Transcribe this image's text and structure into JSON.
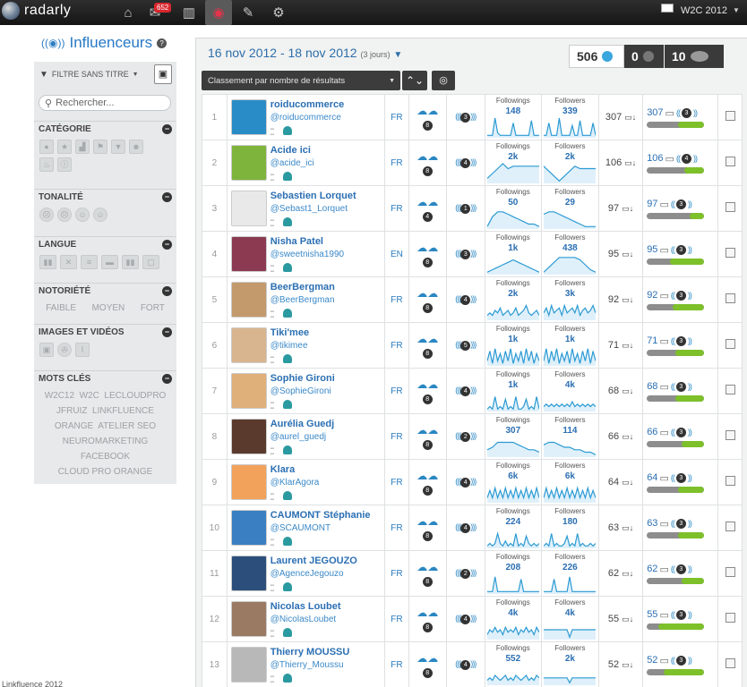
{
  "app": {
    "logo": "radarly",
    "project": "W2C 2012",
    "notif_count": "652"
  },
  "nav": [
    {
      "name": "home-icon",
      "glyph": "⌂"
    },
    {
      "name": "messages-icon",
      "glyph": "✉"
    },
    {
      "name": "stats-icon",
      "glyph": "▥"
    },
    {
      "name": "influencers-icon",
      "glyph": "◉"
    },
    {
      "name": "edit-icon",
      "glyph": "✎"
    },
    {
      "name": "settings-icon",
      "glyph": "⚙"
    }
  ],
  "sidebar": {
    "title": "Influenceurs",
    "filter": "FILTRE SANS TITRE",
    "search_placeholder": "Rechercher...",
    "sections": {
      "category": "CATÉGORIE",
      "tone": "TONALITÉ",
      "language": "LANGUE",
      "notoriety": "NOTORIÉTÉ",
      "media": "IMAGES ET VIDÉOS",
      "keywords": "MOTS CLÉS"
    },
    "notoriety_levels": [
      "FAIBLE",
      "MOYEN",
      "FORT"
    ],
    "keywords": [
      "W2C12",
      "W2C",
      "LECLOUDPRO",
      "JFRUIZ",
      "LINKFLUENCE",
      "ORANGE",
      "ATELIER SEO",
      "NEUROMARKETING",
      "FACEBOOK",
      "CLOUD PRO ORANGE"
    ]
  },
  "header": {
    "date_range": "16 nov 2012 - 18 nov 2012",
    "days": "(3 jours)",
    "twitter_count": "506",
    "facebook_count": "0",
    "other_count": "10",
    "sort_label": "Classement par nombre de résultats"
  },
  "columns": {
    "followings": "Followings",
    "followers": "Followers"
  },
  "rows": [
    {
      "rank": "1",
      "name": "roiducommerce",
      "handle": "@roiducommerce",
      "lang": "FR",
      "ring": "8",
      "ring2": "3",
      "followings": "148",
      "followers": "339",
      "score": "307",
      "reach": "307",
      "reach_ring": "3",
      "bar": 0.45,
      "avatar": "#2a8cc6",
      "ch1": [
        1,
        1,
        1,
        8,
        2,
        1,
        1,
        1,
        1,
        1,
        6,
        1,
        1,
        1,
        1,
        1,
        1,
        7,
        1,
        1,
        1
      ],
      "ch2": [
        1,
        1,
        6,
        1,
        1,
        1,
        8,
        1,
        1,
        1,
        1,
        5,
        1,
        1,
        7,
        1,
        1,
        1,
        1,
        6,
        1
      ]
    },
    {
      "rank": "2",
      "name": "Acide ici",
      "handle": "@acide_ici",
      "lang": "FR",
      "ring": "8",
      "ring2": "4",
      "followings": "2k",
      "followers": "2k",
      "score": "106",
      "reach": "106",
      "reach_ring": "4",
      "bar": 0.35,
      "avatar": "#7fb43c",
      "ch1": [
        2,
        4,
        6,
        8,
        6,
        7,
        7,
        7,
        7,
        7,
        7
      ],
      "ch2": [
        7,
        5,
        3,
        1,
        3,
        5,
        7,
        6,
        6,
        6,
        6
      ]
    },
    {
      "rank": "3",
      "name": "Sebastien Lorquet",
      "handle": "@Sebast1_Lorquet",
      "lang": "FR",
      "ring": "4",
      "ring2": "1",
      "followings": "50",
      "followers": "29",
      "score": "97",
      "reach": "97",
      "reach_ring": "3",
      "bar": 0.25,
      "avatar": "#e9e9e9",
      "ch1": [
        1,
        5,
        7,
        7,
        6,
        5,
        4,
        3,
        2,
        2,
        1
      ],
      "ch2": [
        6,
        7,
        7,
        6,
        5,
        4,
        3,
        2,
        1,
        1,
        1
      ]
    },
    {
      "rank": "4",
      "name": "Nisha Patel",
      "handle": "@sweetnisha1990",
      "lang": "EN",
      "ring": "8",
      "ring2": "3",
      "followings": "1k",
      "followers": "438",
      "score": "95",
      "reach": "95",
      "reach_ring": "3",
      "bar": 0.6,
      "avatar": "#8b3a52",
      "ch1": [
        1,
        2,
        3,
        4,
        5,
        6,
        5,
        4,
        3,
        2,
        1
      ],
      "ch2": [
        1,
        3,
        5,
        7,
        7,
        7,
        7,
        6,
        4,
        2,
        1
      ]
    },
    {
      "rank": "5",
      "name": "BeerBergman",
      "handle": "@BeerBergman",
      "lang": "FR",
      "ring": "8",
      "ring2": "4",
      "followings": "2k",
      "followers": "3k",
      "score": "92",
      "reach": "92",
      "reach_ring": "3",
      "bar": 0.55,
      "avatar": "#c39a6b",
      "ch1": [
        2,
        3,
        2,
        4,
        3,
        5,
        2,
        3,
        4,
        2,
        3,
        5,
        2,
        3,
        4,
        6,
        3,
        2,
        3,
        4,
        2
      ],
      "ch2": [
        3,
        5,
        2,
        6,
        3,
        4,
        5,
        2,
        6,
        3,
        4,
        5,
        3,
        6,
        2,
        4,
        5,
        3,
        4,
        6,
        3
      ]
    },
    {
      "rank": "6",
      "name": "Tiki'mee",
      "handle": "@tikimee",
      "lang": "FR",
      "ring": "8",
      "ring2": "5",
      "followings": "1k",
      "followers": "1k",
      "score": "71",
      "reach": "71",
      "reach_ring": "3",
      "bar": 0.5,
      "avatar": "#d9b58f",
      "ch1": [
        2,
        6,
        1,
        7,
        2,
        5,
        1,
        6,
        2,
        7,
        1,
        5,
        2,
        6,
        1,
        7,
        2,
        6,
        1,
        5,
        2
      ],
      "ch2": [
        2,
        7,
        1,
        6,
        2,
        7,
        1,
        5,
        2,
        6,
        1,
        7,
        2,
        5,
        1,
        6,
        2,
        7,
        1,
        6,
        2
      ]
    },
    {
      "rank": "7",
      "name": "Sophie Gironi",
      "handle": "@SophieGironi",
      "lang": "FR",
      "ring": "8",
      "ring2": "4",
      "followings": "1k",
      "followers": "4k",
      "score": "68",
      "reach": "68",
      "reach_ring": "3",
      "bar": 0.5,
      "avatar": "#e0b07a",
      "ch1": [
        1,
        2,
        1,
        6,
        1,
        2,
        1,
        5,
        1,
        2,
        1,
        6,
        1,
        1,
        2,
        5,
        1,
        2,
        1,
        6,
        1
      ],
      "ch2": [
        2,
        3,
        2,
        3,
        2,
        3,
        2,
        3,
        2,
        3,
        2,
        4,
        2,
        3,
        2,
        3,
        2,
        3,
        2,
        3,
        2
      ]
    },
    {
      "rank": "8",
      "name": "Aurélia Guedj",
      "handle": "@aurel_guedj",
      "lang": "FR",
      "ring": "8",
      "ring2": "2",
      "followings": "307",
      "followers": "114",
      "score": "66",
      "reach": "66",
      "reach_ring": "3",
      "bar": 0.4,
      "avatar": "#5b3a2e",
      "ch1": [
        3,
        4,
        6,
        6,
        6,
        6,
        5,
        4,
        3,
        3,
        2
      ],
      "ch2": [
        5,
        6,
        6,
        5,
        4,
        4,
        3,
        3,
        2,
        2,
        1
      ]
    },
    {
      "rank": "9",
      "name": "Klara",
      "handle": "@KlarAgora",
      "lang": "FR",
      "ring": "8",
      "ring2": "4",
      "followings": "6k",
      "followers": "6k",
      "score": "64",
      "reach": "64",
      "reach_ring": "3",
      "bar": 0.45,
      "avatar": "#f2a25a",
      "ch1": [
        2,
        5,
        2,
        6,
        2,
        5,
        2,
        6,
        2,
        5,
        2,
        6,
        2,
        5,
        2,
        6,
        2,
        5,
        2,
        6,
        2
      ],
      "ch2": [
        2,
        6,
        2,
        5,
        2,
        6,
        2,
        5,
        2,
        6,
        2,
        5,
        2,
        6,
        2,
        5,
        2,
        6,
        2,
        5,
        2
      ]
    },
    {
      "rank": "10",
      "name": "CAUMONT Stéphanie",
      "handle": "@SCAUMONT",
      "lang": "FR",
      "ring": "8",
      "ring2": "4",
      "followings": "224",
      "followers": "180",
      "score": "63",
      "reach": "63",
      "reach_ring": "3",
      "bar": 0.45,
      "avatar": "#3a7fc2",
      "ch1": [
        1,
        2,
        1,
        2,
        6,
        2,
        1,
        3,
        1,
        2,
        1,
        6,
        1,
        2,
        1,
        5,
        2,
        1,
        2,
        1,
        2
      ],
      "ch2": [
        1,
        2,
        1,
        6,
        1,
        2,
        1,
        1,
        2,
        5,
        1,
        2,
        1,
        6,
        1,
        2,
        1,
        1,
        2,
        1,
        2
      ]
    },
    {
      "rank": "11",
      "name": "Laurent JEGOUZO",
      "handle": "@AgenceJegouzo",
      "lang": "FR",
      "ring": "8",
      "ring2": "2",
      "followings": "208",
      "followers": "226",
      "score": "62",
      "reach": "62",
      "reach_ring": "3",
      "bar": 0.4,
      "avatar": "#2b4f7a",
      "ch1": [
        1,
        1,
        1,
        7,
        1,
        1,
        1,
        1,
        1,
        1,
        1,
        1,
        1,
        6,
        1,
        1,
        1,
        1,
        1,
        1,
        1
      ],
      "ch2": [
        1,
        1,
        1,
        1,
        6,
        1,
        1,
        1,
        1,
        1,
        7,
        1,
        1,
        1,
        1,
        1,
        1,
        1,
        1,
        1,
        1
      ]
    },
    {
      "rank": "12",
      "name": "Nicolas Loubet",
      "handle": "@NicolasLoubet",
      "lang": "FR",
      "ring": "8",
      "ring2": "4",
      "followings": "4k",
      "followers": "4k",
      "score": "55",
      "reach": "55",
      "reach_ring": "3",
      "bar": 0.8,
      "avatar": "#9a7a62",
      "ch1": [
        2,
        4,
        3,
        5,
        3,
        4,
        2,
        5,
        3,
        4,
        3,
        5,
        2,
        4,
        3,
        5,
        3,
        4,
        2,
        5,
        3
      ],
      "ch2": [
        4,
        4,
        4,
        4,
        4,
        4,
        4,
        4,
        4,
        4,
        1,
        4,
        4,
        4,
        4,
        4,
        4,
        4,
        4,
        4,
        4
      ]
    },
    {
      "rank": "13",
      "name": "Thierry MOUSSU",
      "handle": "@Thierry_Moussu",
      "lang": "FR",
      "ring": "8",
      "ring2": "4",
      "followings": "552",
      "followers": "2k",
      "score": "52",
      "reach": "52",
      "reach_ring": "3",
      "bar": 0.7,
      "avatar": "#b8b8b8",
      "ch1": [
        2,
        3,
        2,
        4,
        3,
        2,
        3,
        4,
        2,
        3,
        2,
        4,
        3,
        2,
        3,
        4,
        2,
        3,
        2,
        4,
        3
      ],
      "ch2": [
        3,
        3,
        3,
        3,
        3,
        3,
        3,
        3,
        3,
        3,
        1,
        3,
        3,
        3,
        3,
        3,
        3,
        3,
        3,
        3,
        3
      ]
    }
  ],
  "footer": "Linkfluence 2012",
  "colors": {
    "accent": "#2679c7",
    "bar_green": "#7dc02a",
    "bar_gray": "#8d8d8d"
  }
}
